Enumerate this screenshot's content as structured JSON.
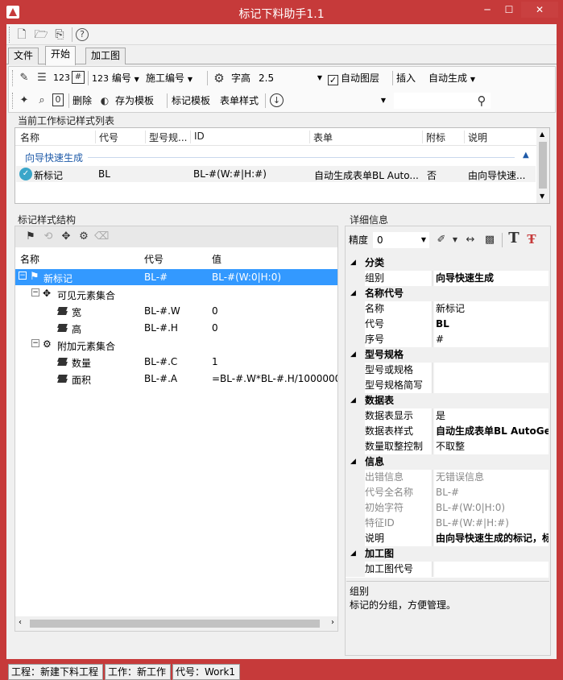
{
  "window": {
    "title": "标记下料助手1.1",
    "min": "─",
    "max": "☐",
    "close": "✕"
  },
  "tabs": [
    "文件",
    "开始",
    "加工图"
  ],
  "ribbon": {
    "numbering_label": "编号",
    "process_label": "施工编号",
    "font_height_label": "字高",
    "font_height_value": "2.5",
    "auto_layer_label": "自动图层",
    "auto_layer_checked": "✓",
    "insert_label": "插入",
    "auto_generate_label": "自动生成",
    "delete_label": "删除",
    "save_template_label": "存为模板",
    "mark_template_label": "标记模板",
    "form_style_label": "表单样式",
    "prefix_123": "123"
  },
  "current_list": {
    "title": "当前工作标记样式列表",
    "columns": [
      "名称",
      "代号",
      "型号规...",
      "ID",
      "表单",
      "附标",
      "说明"
    ],
    "group": "向导快速生成",
    "rows": [
      {
        "name": "新标记",
        "code": "BL",
        "id": "BL-#(W:#|H:#)",
        "form": "自动生成表单BL Auto...",
        "attach": "否",
        "desc": "由向导快速..."
      }
    ]
  },
  "structure": {
    "title": "标记样式结构",
    "columns": [
      "名称",
      "代号",
      "值"
    ],
    "nodes": [
      {
        "name": "新标记",
        "code": "BL-#",
        "value": "BL-#(W:0|H:0)"
      },
      {
        "name": "可见元素集合",
        "code": "",
        "value": ""
      },
      {
        "name": "宽",
        "code": "BL-#.W",
        "value": "0"
      },
      {
        "name": "高",
        "code": "BL-#.H",
        "value": "0"
      },
      {
        "name": "附加元素集合",
        "code": "",
        "value": ""
      },
      {
        "name": "数量",
        "code": "BL-#.C",
        "value": "1"
      },
      {
        "name": "面积",
        "code": "BL-#.A",
        "value": "=BL-#.W*BL-#.H/1000000"
      }
    ]
  },
  "details": {
    "title": "详细信息",
    "precision_label": "精度",
    "precision_value": "0",
    "categories": [
      {
        "name": "分类",
        "props": [
          {
            "k": "组别",
            "v": "向导快速生成",
            "bold": true
          }
        ]
      },
      {
        "name": "名称代号",
        "props": [
          {
            "k": "名称",
            "v": "新标记"
          },
          {
            "k": "代号",
            "v": "BL",
            "bold": true
          },
          {
            "k": "序号",
            "v": "#"
          }
        ]
      },
      {
        "name": "型号规格",
        "props": [
          {
            "k": "型号或规格",
            "v": ""
          },
          {
            "k": "型号规格简写",
            "v": ""
          }
        ]
      },
      {
        "name": "数据表",
        "props": [
          {
            "k": "数据表显示",
            "v": "是"
          },
          {
            "k": "数据表样式",
            "v": "自动生成表单BL AutoGe",
            "bold": true
          },
          {
            "k": "数量取整控制",
            "v": "不取整"
          }
        ]
      },
      {
        "name": "信息",
        "props": [
          {
            "k": "出错信息",
            "v": "无错误信息",
            "gray": true
          },
          {
            "k": "代号全名称",
            "v": "BL-#",
            "gray": true
          },
          {
            "k": "初始字符",
            "v": "BL-#(W:0|H:0)",
            "gray": true
          },
          {
            "k": "特征ID",
            "v": "BL-#(W:#|H:#)",
            "gray": true
          },
          {
            "k": "说明",
            "v": "由向导快速生成的标记，标",
            "bold": true
          }
        ]
      },
      {
        "name": "加工图",
        "props": [
          {
            "k": "加工图代号",
            "v": ""
          }
        ]
      }
    ],
    "help_title": "组别",
    "help_text": "标记的分组，方便管理。"
  },
  "status": {
    "project": "工程：新建下料工程",
    "work": "工作：新工作",
    "code": "代号：Work1"
  }
}
